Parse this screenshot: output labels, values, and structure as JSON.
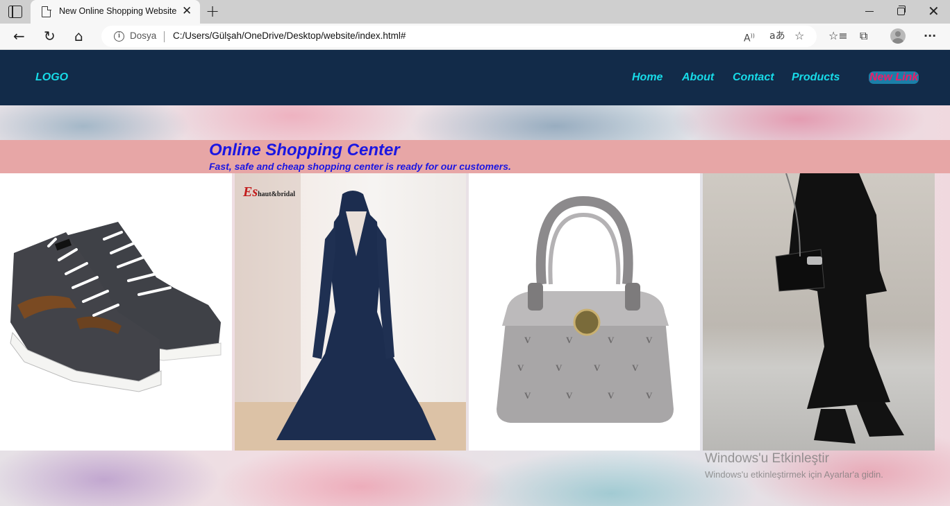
{
  "browser": {
    "tab_title": "New Online Shopping Website",
    "address_prefix": "Dosya",
    "url": "C:/Users/Gülşah/OneDrive/Desktop/website/index.html#"
  },
  "navbar": {
    "logo": "LOGO",
    "links": [
      "Home",
      "About",
      "Contact",
      "Products"
    ],
    "new_link": "New Link",
    "colors": {
      "background": "#122b49",
      "link": "#17dbe8",
      "new_link_text": "#ee1b67",
      "new_link_bg": "#1b7fa8"
    }
  },
  "banner": {
    "title": "Online Shopping Center",
    "subtitle": "Fast, safe and cheap shopping center is ready for our customers.",
    "colors": {
      "background": "#e7a6a6",
      "text": "#1b16e2"
    }
  },
  "products": {
    "dress_brand": "Es",
    "dress_brand_suffix": "haut&bridal"
  },
  "activation": {
    "title": "Windows'u Etkinleştir",
    "subtitle": "Windows'u etkinleştirmek için Ayarlar'a gidin."
  }
}
